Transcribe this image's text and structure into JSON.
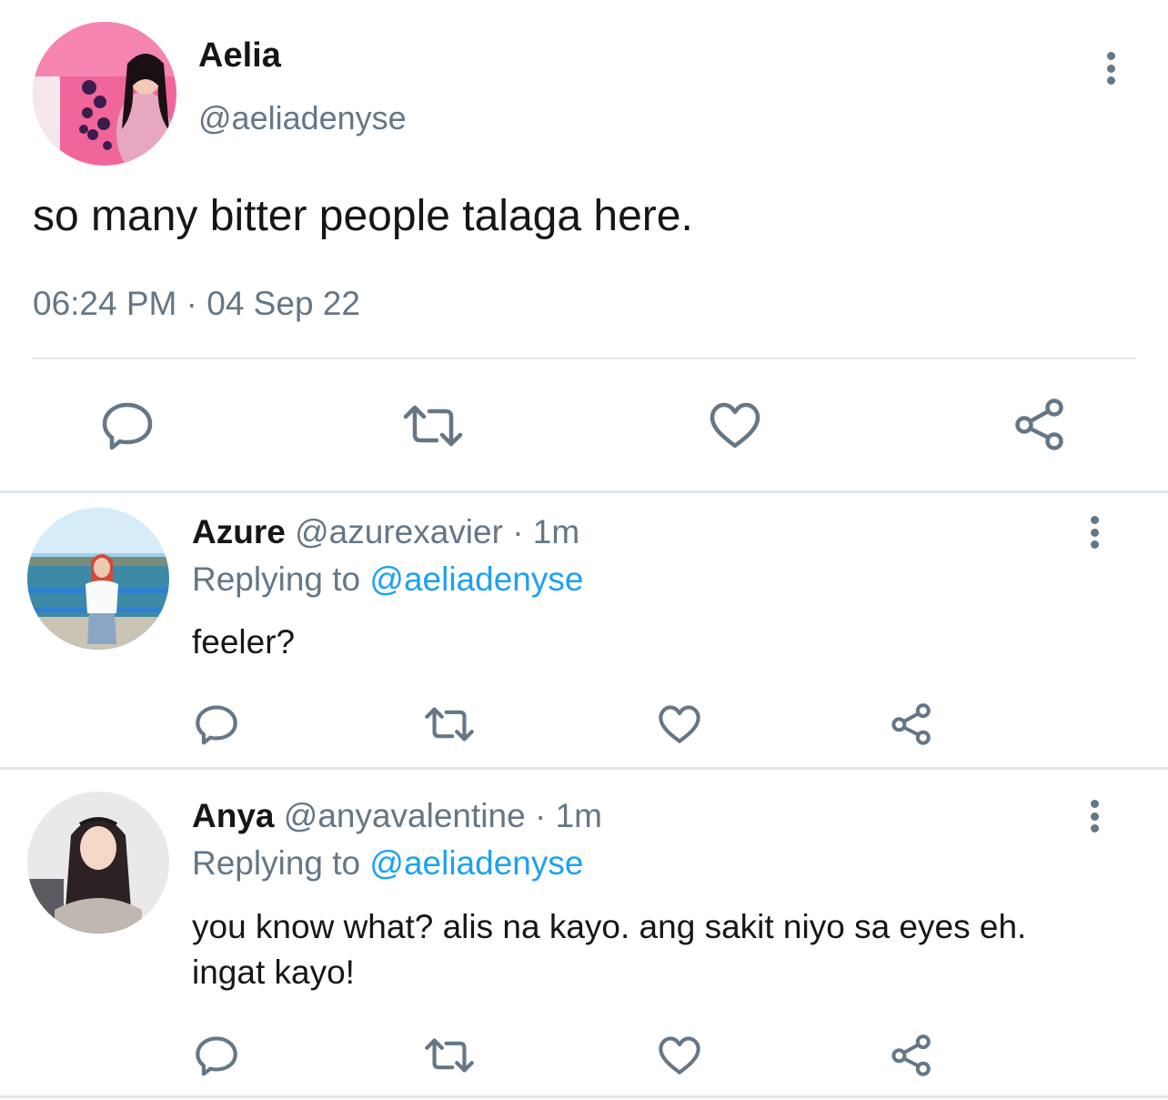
{
  "main_tweet": {
    "name": "Aelia",
    "handle": "@aeliadenyse",
    "text": "so many bitter people talaga here.",
    "timestamp": "06:24 PM · 04 Sep 22",
    "actions": [
      "reply-icon",
      "retweet-icon",
      "like-icon",
      "share-icon"
    ]
  },
  "replies": [
    {
      "name": "Azure",
      "handle": "@azurexavier",
      "time_sep": "·",
      "time": "1m",
      "replying_label": "Replying to",
      "replying_to": "@aeliadenyse",
      "text": "feeler?"
    },
    {
      "name": "Anya",
      "handle": "@anyavalentine",
      "time_sep": "·",
      "time": "1m",
      "replying_label": "Replying to",
      "replying_to": "@aeliadenyse",
      "text": "you know what? alis na kayo. ang sakit niyo sa eyes eh. ingat kayo!"
    }
  ],
  "colors": {
    "text": "#14171a",
    "secondary": "#657786",
    "link": "#1da1f2",
    "divider": "#e1e8ed"
  }
}
